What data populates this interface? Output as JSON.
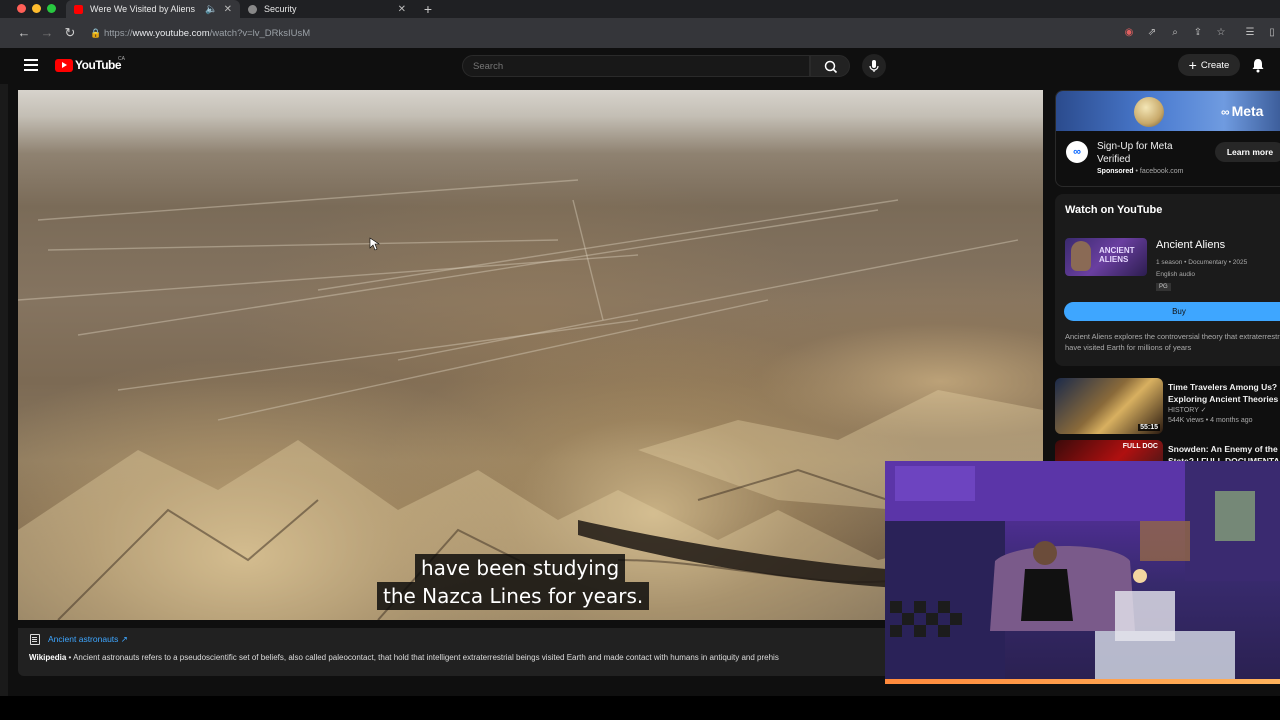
{
  "browser": {
    "tabs": [
      {
        "title": "Were We Visited by Aliens",
        "active": true
      },
      {
        "title": "Security",
        "active": false
      }
    ],
    "url_prefix": "https://",
    "url_host": "www.youtube.com",
    "url_path": "/watch?v=lv_DRksIUsM"
  },
  "youtube": {
    "logo_text": "YouTube",
    "country_code": "CA",
    "search_placeholder": "Search",
    "create_label": "Create"
  },
  "video": {
    "subtitle_line1": "have been studying",
    "subtitle_line2": "the Nazca Lines for years."
  },
  "info_panel": {
    "topic_link": "Ancient astronauts ↗",
    "source": "Wikipedia",
    "description": " • Ancient astronauts refers to a pseudoscientific set of beliefs, also called paleocontact, that hold that intelligent extraterrestrial beings visited Earth and made contact with humans in antiquity and prehis"
  },
  "ad": {
    "brand": "Meta",
    "title": "Sign-Up for Meta Verified",
    "sponsored": "Sponsored",
    "domain": " • facebook.com",
    "cta": "Learn more"
  },
  "watch_card": {
    "heading": "Watch on YouTube",
    "thumb_text": "ANCIENT ALIENS",
    "title": "Ancient Aliens",
    "meta1": "1 season • Documentary • 2025",
    "meta2": "English audio",
    "rating": "PG",
    "buy_label": "Buy",
    "description": "Ancient Aliens explores the controversial theory that extraterrestrials have visited Earth for millions of years"
  },
  "recommendations": [
    {
      "title": "Time Travelers Among Us? Exploring Ancient Theories",
      "channel": "HISTORY ✓",
      "views": "544K views • 4 months ago",
      "duration": "55:15"
    },
    {
      "title": "Snowden: An Enemy of the State? | FULL DOCUMENTARY",
      "channel": "",
      "views": "",
      "duration": "",
      "badge": "FULL DOC"
    }
  ],
  "colors": {
    "youtube_red": "#ff0000",
    "link_blue": "#3ea6ff",
    "meta_blue": "#0866ff"
  }
}
